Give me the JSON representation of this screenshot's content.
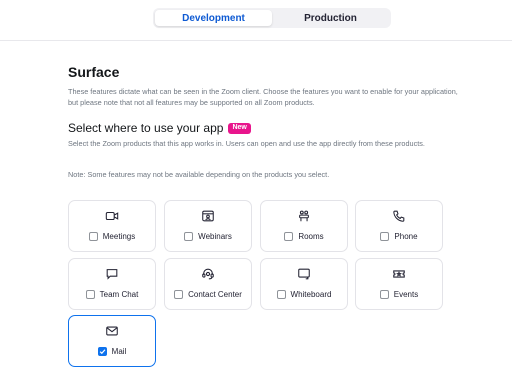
{
  "tabs": {
    "development": "Development",
    "production": "Production"
  },
  "surface": {
    "title": "Surface",
    "description": "These features dictate what can be seen in the Zoom client. Choose the features you want to enable for your application, but please note that not all features may be supported on all Zoom products."
  },
  "select_section": {
    "title": "Select where to use your app",
    "badge": "New",
    "description": "Select the Zoom products that this app works in. Users can open and use the app directly from these products.",
    "note": "Note: Some features may not be available depending on the products you select."
  },
  "products": [
    {
      "label": "Meetings",
      "icon": "video-camera-icon",
      "checked": false
    },
    {
      "label": "Webinars",
      "icon": "webinar-icon",
      "checked": false
    },
    {
      "label": "Rooms",
      "icon": "rooms-icon",
      "checked": false
    },
    {
      "label": "Phone",
      "icon": "phone-icon",
      "checked": false
    },
    {
      "label": "Team Chat",
      "icon": "chat-bubble-icon",
      "checked": false
    },
    {
      "label": "Contact Center",
      "icon": "headset-icon",
      "checked": false
    },
    {
      "label": "Whiteboard",
      "icon": "whiteboard-icon",
      "checked": false
    },
    {
      "label": "Events",
      "icon": "ticket-icon",
      "checked": false
    },
    {
      "label": "Mail",
      "icon": "mail-icon",
      "checked": true
    }
  ],
  "colors": {
    "accent": "#0e72ed",
    "badge": "#e8158c"
  }
}
